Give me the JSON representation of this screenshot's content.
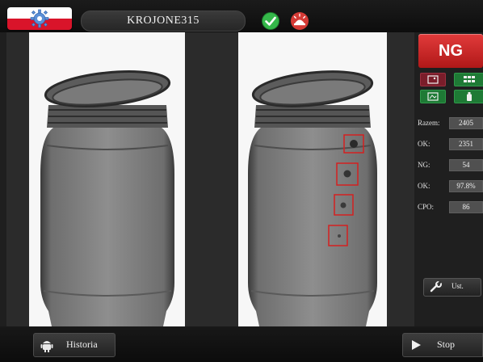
{
  "header": {
    "product_name": "KROJONE315",
    "status_ok_icon": "check-circle-icon",
    "light_icon": "warning-light-icon",
    "flag_colors": [
      "#ffffff",
      "#d9142a"
    ]
  },
  "inspection": {
    "left_view_icon": "jar-xray-image",
    "right_view_icon": "jar-xray-image-with-defects",
    "defect_marker_color": "#d42020",
    "defects_marked": 4
  },
  "sidebar": {
    "result": "NG",
    "result_color": "#c8201f",
    "view_buttons": [
      {
        "icon": "single-view-icon",
        "color": "#7a1d2a"
      },
      {
        "icon": "grid-view-icon",
        "color": "#1e7a35"
      },
      {
        "icon": "image-toggle-icon",
        "color": "#1e7a35"
      },
      {
        "icon": "bottle-icon",
        "color": "#1e7a35"
      }
    ],
    "stats": [
      {
        "label": "Razem:",
        "value": "2405"
      },
      {
        "label": "OK:",
        "value": "2351"
      },
      {
        "label": "NG:",
        "value": "54"
      },
      {
        "label": "OK:",
        "value": "97.8%"
      },
      {
        "label": "CPO:",
        "value": "86"
      }
    ],
    "settings_button": {
      "label": "Ust.",
      "icon": "wrench-icon"
    }
  },
  "footer": {
    "history_button": {
      "label": "Historia",
      "icon": "android-icon"
    },
    "stop_button": {
      "label": "Stop",
      "icon": "play-icon"
    }
  }
}
